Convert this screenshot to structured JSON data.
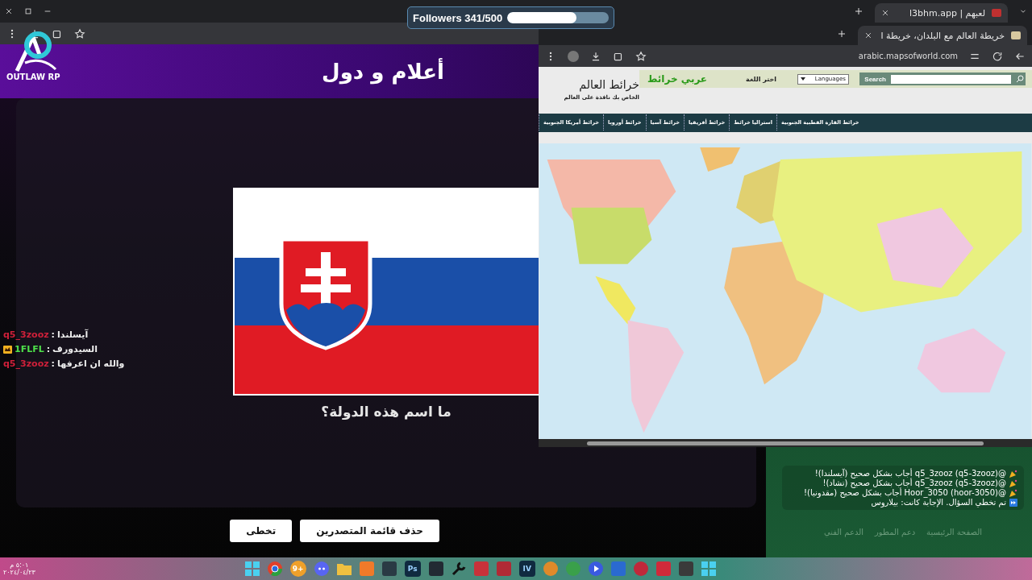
{
  "left_window": {
    "tab": {
      "title": "لعبهم | l3bhm.app"
    }
  },
  "followers": {
    "label": "Followers 341/500",
    "level": 0.68
  },
  "logo": {
    "text": "OUTLAW RP"
  },
  "game": {
    "title": "أعلام و دول",
    "question": "ما اسم هذه الدولة؟",
    "buttons": [
      "حذف قائمة المتصدرين",
      "تخطى"
    ],
    "chat": [
      {
        "user": "q5_3zooz",
        "message": "آيسلندا",
        "separator": ":",
        "color": "#d0203a",
        "badge": false
      },
      {
        "user": "1FLFL",
        "message": "السيدورف",
        "separator": ":",
        "color": "#4ee04a",
        "badge": true
      },
      {
        "user": "q5_3zooz",
        "message": "والله ان اعرفها",
        "separator": ":",
        "color": "#d0203a",
        "badge": false
      }
    ],
    "log": [
      {
        "kind": "correct",
        "text": "@q5_3zooz (q5-3zooz) أجاب بشكل صحيح (آيسلندا)!"
      },
      {
        "kind": "correct",
        "text": "@q5_3zooz (q5-3zooz) أجاب بشكل صحيح (تشاد)!"
      },
      {
        "kind": "correct",
        "text": "@Hoor_3050 (hoor-3050) أجاب بشكل صحيح (مقدونيا)!"
      },
      {
        "kind": "skip",
        "text": "تم تخطي السؤال. الإجابة كانت: بيلاروس"
      }
    ],
    "footer_links": [
      "الصفحة الرئيسية",
      "دعم المطور",
      "الدعم الفني"
    ]
  },
  "right_window": {
    "tab": {
      "title": "خريطة العالم مع البلدان، خريطة ا"
    },
    "url": "arabic.mapsofworld.com",
    "site": {
      "title": "خرائط العالم",
      "tagline": "الخاص بك نافذة على العالم",
      "brand": "عربي خرائط",
      "language_label": "اختر اللغة",
      "language_select": "Languages",
      "search_button": "Search",
      "nav": [
        "خرائط القارة القطبية الجنوبية",
        "استراليا خرائط",
        "خرائط أفريقيا",
        "خرائط آسيا",
        "خرائط أوروبا",
        "خرائط أمريكا الجنوبية"
      ]
    }
  },
  "taskbar": {
    "clock": {
      "time": "٥:٠١ م",
      "date": "٢٠٢٤/٠٤/٢٣"
    },
    "apps": [
      {
        "kind": "grid"
      },
      {
        "kind": "tile",
        "color": "#3a3a3a"
      },
      {
        "kind": "tile",
        "color": "#d02a3a"
      },
      {
        "kind": "circle",
        "color": "#c0283a"
      },
      {
        "kind": "tile",
        "color": "#2a6ad0"
      },
      {
        "kind": "play"
      },
      {
        "kind": "circle",
        "color": "#3aa04a"
      },
      {
        "kind": "circle",
        "color": "#e08a2a"
      },
      {
        "kind": "text",
        "label": "IV"
      },
      {
        "kind": "tile",
        "color": "#b02a35"
      },
      {
        "kind": "tile",
        "color": "#c8323a"
      },
      {
        "kind": "wrench"
      },
      {
        "kind": "tile",
        "color": "#222a33"
      },
      {
        "kind": "text",
        "label": "Ps"
      },
      {
        "kind": "tile",
        "color": "#2a3a44"
      },
      {
        "kind": "tile",
        "color": "#f07a2a"
      },
      {
        "kind": "folder"
      },
      {
        "kind": "chat"
      },
      {
        "kind": "badge",
        "label": "9+"
      },
      {
        "kind": "globe"
      },
      {
        "kind": "grid"
      }
    ]
  }
}
